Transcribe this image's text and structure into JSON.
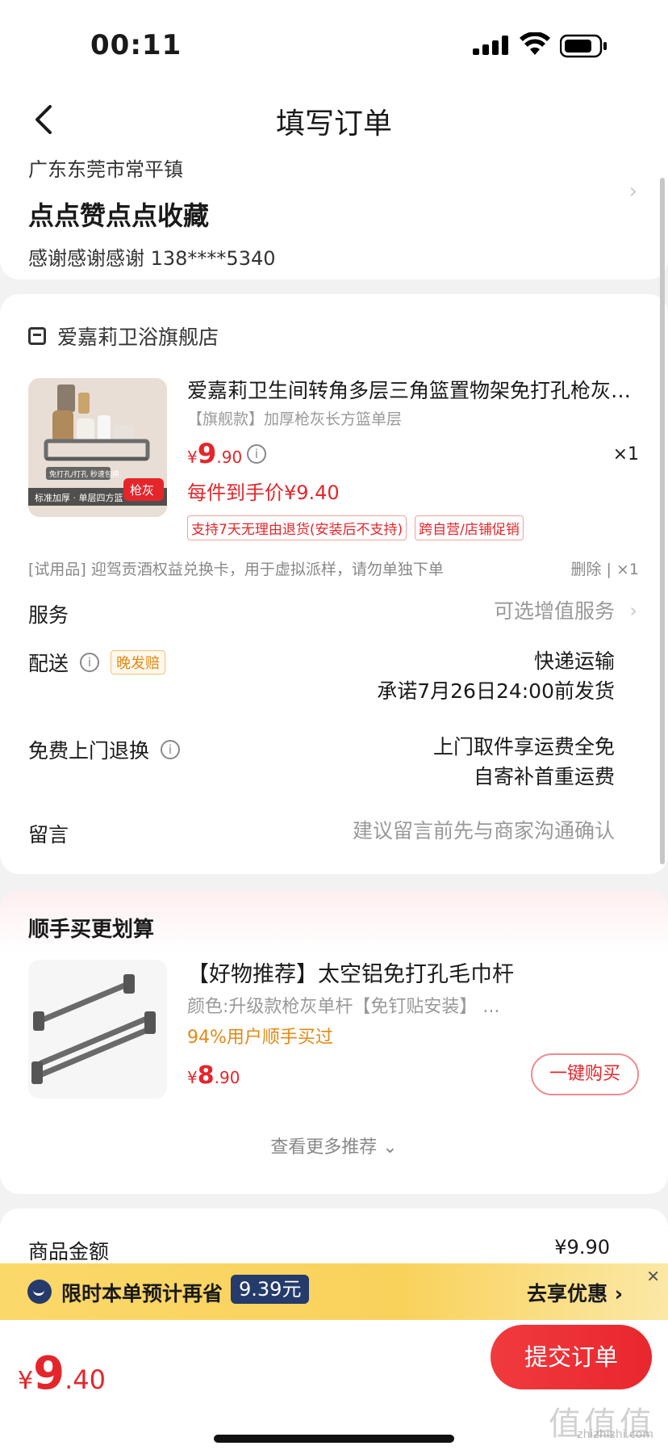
{
  "status": {
    "time": "00:11"
  },
  "nav": {
    "title": "填写订单"
  },
  "address": {
    "region": "广东东莞市常平镇",
    "name": "点点赞点点收藏",
    "contact": "感谢感谢感谢  138****5340"
  },
  "store": {
    "name": "爱嘉莉卫浴旗舰店"
  },
  "product": {
    "title": "爱嘉莉卫生间转角多层三角篮置物架免打孔枪灰…",
    "spec": "【旗舰款】加厚枪灰长方篮单层",
    "price_symbol": "¥",
    "price_int": "9",
    "price_dec": ".90",
    "qty": "×1",
    "final_price": "每件到手价¥9.40",
    "tags": [
      "支持7天无理由退货(安装后不支持)",
      "跨自营/店铺促销"
    ],
    "image_labels": [
      "免打孔/打孔 秒速包换",
      "标准加厚 · 单层四方篮",
      "枪灰"
    ]
  },
  "trial": {
    "text": "[试用品] 迎驾贡酒权益兑换卡，用于虚拟派样，请勿单独下单",
    "right": "删除 | ×1"
  },
  "service": {
    "label": "服务",
    "hint": "可选增值服务"
  },
  "delivery": {
    "label": "配送",
    "badge": "晚发赔",
    "method": "快递运输",
    "promise": "承诺7月26日24:00前发货"
  },
  "return": {
    "label": "免费上门退换",
    "line1": "上门取件享运费全免",
    "line2": "自寄补首重运费"
  },
  "message": {
    "label": "留言",
    "hint": "建议留言前先与商家沟通确认"
  },
  "upsell": {
    "title": "顺手买更划算",
    "item_title": "【好物推荐】太空铝免打孔毛巾杆",
    "item_spec": "颜色:升级款枪灰单杆【免钉贴安装】 ...",
    "item_social": "94%用户顺手买过",
    "price_symbol": "¥",
    "price_int": "8",
    "price_dec": ".90",
    "buy_label": "一键购买",
    "more_label": "查看更多推荐 ⌄"
  },
  "summary": {
    "label": "商品金额",
    "value": "¥9.90"
  },
  "promo": {
    "text": "限时本单预计再省",
    "badge": "9.39元",
    "link": "去享优惠 ›"
  },
  "bottom": {
    "price_symbol": "¥",
    "price_int": "9",
    "price_dec": ".40",
    "submit_label": "提交订单",
    "watermark": "值值值",
    "watermark_sub": "zhizhizhi.com"
  },
  "colors": {
    "accent": "#e4262b",
    "promo_bg": "#f9d25c",
    "badge_navy": "#243b6b"
  }
}
